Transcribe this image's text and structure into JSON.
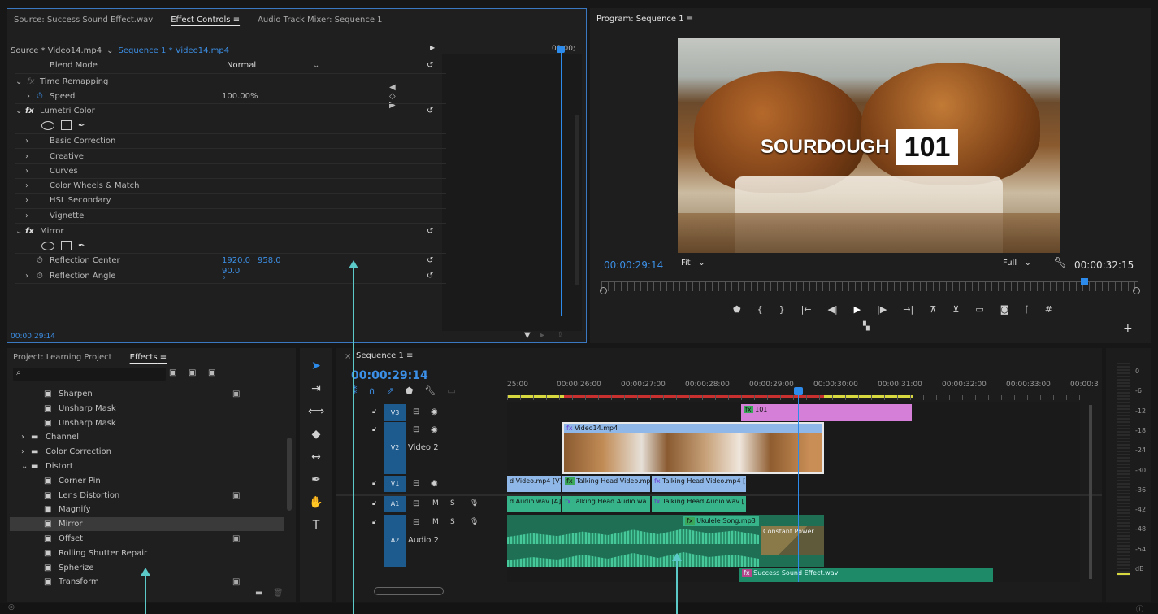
{
  "effect_controls": {
    "tabs": [
      "Source: Success Sound Effect.wav",
      "Effect Controls",
      "Audio Track Mixer: Sequence 1"
    ],
    "source_label": "Source * Video14.mp4",
    "sequence_label": "Sequence 1 * Video14.mp4",
    "mini_time": "00;00;",
    "rows": {
      "blend_mode": "Blend Mode",
      "blend_value": "Normal",
      "time_remap": "Time Remapping",
      "speed": "Speed",
      "speed_value": "100.00%",
      "lumetri": "Lumetri Color",
      "basic": "Basic Correction",
      "creative": "Creative",
      "curves": "Curves",
      "wheels": "Color Wheels & Match",
      "hsl": "HSL Secondary",
      "vignette": "Vignette",
      "mirror": "Mirror",
      "refl_center": "Reflection Center",
      "refl_center_x": "1920.0",
      "refl_center_y": "958.0",
      "refl_angle": "Reflection Angle",
      "refl_angle_value": "90.0 °"
    },
    "timecode": "00:00:29:14"
  },
  "program": {
    "title": "Program: Sequence 1",
    "overlay_word": "SOURDOUGH",
    "overlay_number": "101",
    "current_time": "00:00:29:14",
    "fit": "Fit",
    "quality": "Full",
    "duration": "00:00:32:15"
  },
  "project": {
    "tabs": [
      "Project: Learning Project",
      "Effects"
    ],
    "items": [
      {
        "label": "Sharpen",
        "type": "effect",
        "indent": 2,
        "badge": true
      },
      {
        "label": "Unsharp Mask",
        "type": "effect",
        "indent": 2,
        "badge": false
      },
      {
        "label": "Unsharp Mask",
        "type": "effect",
        "indent": 2,
        "badge": false
      },
      {
        "label": "Channel",
        "type": "folder",
        "indent": 1,
        "badge": false
      },
      {
        "label": "Color Correction",
        "type": "folder",
        "indent": 1,
        "badge": false
      },
      {
        "label": "Distort",
        "type": "folder-open",
        "indent": 1,
        "badge": false
      },
      {
        "label": "Corner Pin",
        "type": "effect",
        "indent": 2,
        "badge": false
      },
      {
        "label": "Lens Distortion",
        "type": "effect",
        "indent": 2,
        "badge": true
      },
      {
        "label": "Magnify",
        "type": "effect",
        "indent": 2,
        "badge": false
      },
      {
        "label": "Mirror",
        "type": "effect",
        "indent": 2,
        "badge": false,
        "selected": true
      },
      {
        "label": "Offset",
        "type": "effect",
        "indent": 2,
        "badge": true
      },
      {
        "label": "Rolling Shutter Repair",
        "type": "effect",
        "indent": 2,
        "badge": false
      },
      {
        "label": "Spherize",
        "type": "effect",
        "indent": 2,
        "badge": false
      },
      {
        "label": "Transform",
        "type": "effect",
        "indent": 2,
        "badge": true
      }
    ]
  },
  "timeline": {
    "title": "Sequence 1",
    "timecode": "00:00:29:14",
    "ruler": [
      "25:00",
      "00:00:26:00",
      "00:00:27:00",
      "00:00:28:00",
      "00:00:29:00",
      "00:00:30:00",
      "00:00:31:00",
      "00:00:32:00",
      "00:00:33:00",
      "00:00:3"
    ],
    "tracks": {
      "v3": "V3",
      "v2": "V2",
      "v2_name": "Video 2",
      "v1": "V1",
      "a1": "A1",
      "a2": "A2",
      "a2_name": "Audio 2",
      "m": "M",
      "s": "S"
    },
    "clips": {
      "c101": "101",
      "video14": "Video14.mp4",
      "th_video_a": "d Video.mp4 [V]",
      "th_video_b": "Talking Head Video.mp",
      "th_video_c": "Talking Head Video.mp4 [",
      "th_audio_a": "d Audio.wav [A]",
      "th_audio_b": "Talking Head Audio.wa",
      "th_audio_c": "Talking Head Audio.wav [",
      "ukulele": "Ukulele Song.mp3",
      "constant_power": "Constant Power",
      "success": "Success Sound Effect.wav"
    }
  },
  "meter": {
    "labels": [
      "0",
      "-6",
      "-12",
      "-18",
      "-24",
      "-30",
      "-36",
      "-42",
      "-48",
      "-54",
      "dB"
    ]
  },
  "colors": {
    "accent": "#2d8ceb",
    "arrow": "#5cc9c9",
    "clip_pink": "#d97ad9",
    "clip_blue": "#8fb8e8",
    "clip_green": "#37b38a",
    "playhead": "#2d8ceb"
  }
}
